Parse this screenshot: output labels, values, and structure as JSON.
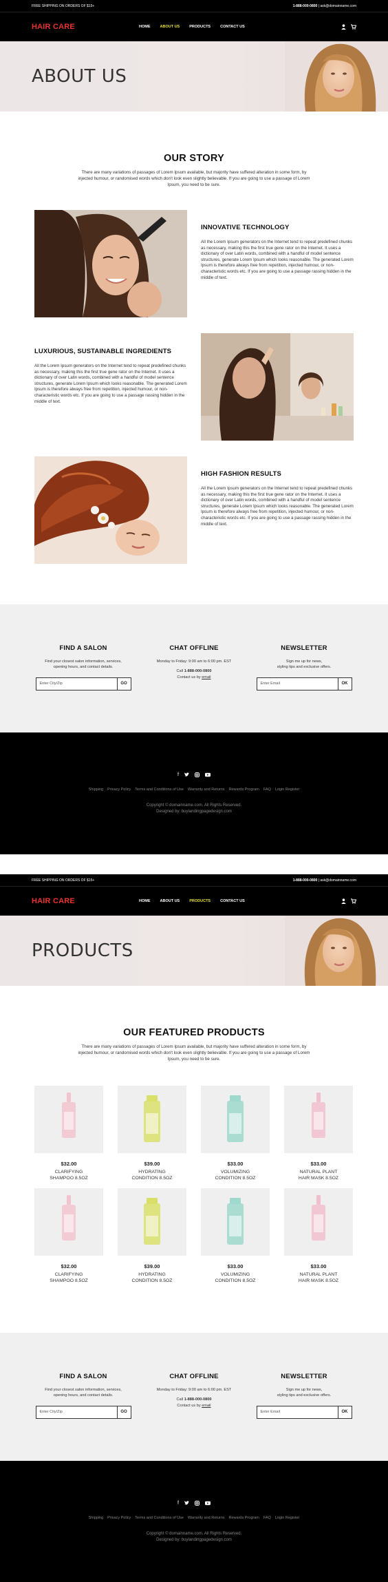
{
  "topbar": {
    "shipping": "FREE SHIPPING ON ORDERS OF $15+",
    "phone": "1-888-000-0800",
    "separator": " | ",
    "email": "ask@domainname.com"
  },
  "nav": {
    "logo": "HAIR CARE",
    "items": [
      "HOME",
      "ABOUT US",
      "PRODUCTS",
      "CONTACT US"
    ],
    "user_icon": "user-icon",
    "cart_icon": "cart-icon"
  },
  "about": {
    "hero_title": "ABOUT US",
    "story_title": "OUR STORY",
    "story_intro": "There are many variations of passages of Lorem Ipsum available, but majority have suffered alteration in some form, by injected humour, or randomised words which don't look even slightly believable. If you are going to use a passage of Lorem Ipsum, you need to be sure.",
    "features": [
      {
        "title": "INNOVATIVE TECHNOLOGY",
        "text": "All the Lorem Ipsum generators on the Internet tend to repeat predefined chunks as necessary, making this the first true gene rator on the Internet. It uses a dictionary of over Latin words, combined with a handful of model sentence structures, generate Lorem Ipsum which looks reasonable. The generated Lorem Ipsum is therefore always free from repetition, injected humour, or non-characteristic words etc. If you are going to use a passage rassing hidden in the middle of text."
      },
      {
        "title": "LUXURIOUS, SUSTAINABLE INGREDIENTS",
        "text": "All the Lorem Ipsum generators on the Internet tend to repeat predefined chunks as necessary, making this the first true gene rator on the Internet. It uses a dictionary of over Latin words, combined with a handful of model sentence structures, generate Lorem Ipsum which looks reasonable. The generated Lorem Ipsum is therefore always free from repetition, injected humour, or non-characteristic words etc. If you are going to use a passage rassing hidden in the middle of text."
      },
      {
        "title": "HIGH FASHION RESULTS",
        "text": "All the Lorem Ipsum generators on the Internet tend to repeat predefined chunks as necessary, making this the first true gene rator on the Internet. It uses a dictionary of over Latin words, combined with a handful of model sentence structures, generate Lorem Ipsum which looks reasonable. The generated Lorem Ipsum is therefore always free from repetition, injected humour, or non-characteristic words etc. If you are going to use a passage rassing hidden in the middle of text."
      }
    ]
  },
  "products_page": {
    "hero_title": "PRODUCTS",
    "featured_title": "OUR FEATURED PRODUCTS",
    "featured_intro": "There are many variations of passages of Lorem Ipsum available, but majority have suffered alteration in some form, by injected humour, or randomised words which don't look even slightly believable. If you are going to use a passage of Lorem Ipsum, you need to be sure.",
    "products": [
      {
        "price": "$32.00",
        "name1": "CLARIFYING",
        "name2": "SHAMPOO 8.5OZ",
        "color": "#f2c4cf"
      },
      {
        "price": "$39.00",
        "name1": "HYDRATING",
        "name2": "CONDITION 8.5OZ",
        "color": "#d9e06a"
      },
      {
        "price": "$33.00",
        "name1": "VOLUMIZING",
        "name2": "CONDITION 8.5OZ",
        "color": "#9fd8cc"
      },
      {
        "price": "$33.00",
        "name1": "NATURAL PLANT",
        "name2": "HAIR MASK 8.5OZ",
        "color": "#f0bfcd"
      },
      {
        "price": "$32.00",
        "name1": "CLARIFYING",
        "name2": "SHAMPOO 8.5OZ",
        "color": "#f2c4cf"
      },
      {
        "price": "$39.00",
        "name1": "HYDRATING",
        "name2": "CONDITION 8.5OZ",
        "color": "#d9e06a"
      },
      {
        "price": "$33.00",
        "name1": "VOLUMIZING",
        "name2": "CONDITION 8.5OZ",
        "color": "#9fd8cc"
      },
      {
        "price": "$33.00",
        "name1": "NATURAL PLANT",
        "name2": "HAIR MASK 8.5OZ",
        "color": "#f0bfcd"
      }
    ]
  },
  "info": {
    "salon_title": "FIND A SALON",
    "salon_text1": "Find your closest salon information, services,",
    "salon_text2": "opening hours, and contact details.",
    "salon_placeholder": "Enter City/Zip",
    "salon_button": "GO",
    "chat_title": "CHAT OFFLINE",
    "chat_hours": "Monday to Friday: 9:00 am to 6:00 pm. EST",
    "chat_call_prefix": "Call ",
    "chat_phone": "1-888-000-0800",
    "chat_contact_prefix": "Contact us by ",
    "chat_email_link": "email",
    "news_title": "NEWSLETTER",
    "news_text1": "Sign me up for news,",
    "news_text2": "styling tips and exclusive offers.",
    "news_placeholder": "Enter Email",
    "news_button": "OK"
  },
  "footer": {
    "social": [
      "facebook-icon",
      "twitter-icon",
      "instagram-icon",
      "youtube-icon"
    ],
    "links": [
      "Shipping",
      "Privacy Policy",
      "Terms and Conditions of Use",
      "Warranty and Returns",
      "Rewards Program",
      "FAQ",
      "Login Register"
    ],
    "copyright": "Copyright © domainname.com. All Rights Reserved.",
    "designed": "Designed by: buylandingpagedesign.com"
  },
  "colors": {
    "logo": "#e8332f",
    "active_nav": "#e8e337",
    "bar_bg": "#000000",
    "info_bg": "#f0f0f0"
  }
}
